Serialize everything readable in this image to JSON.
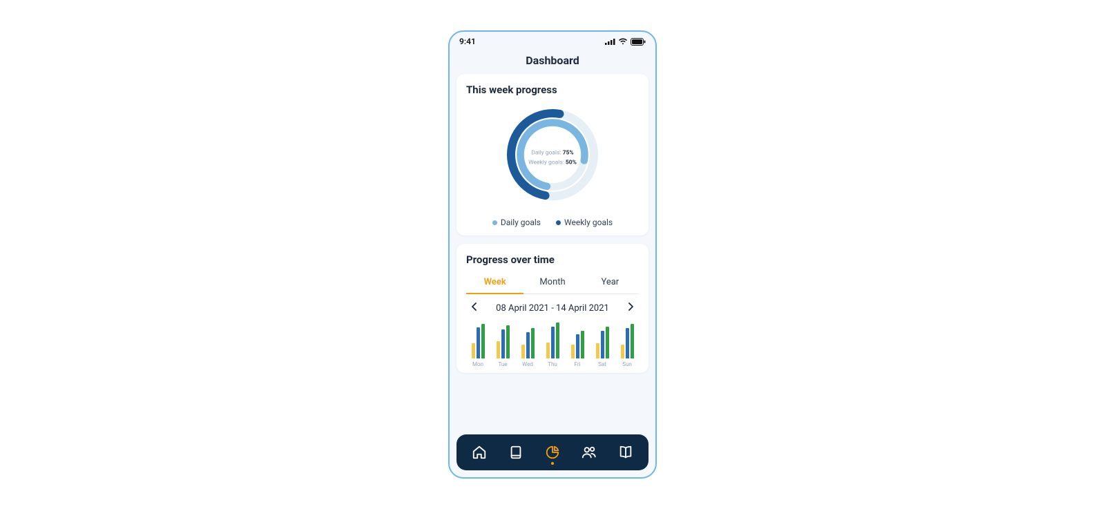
{
  "status": {
    "time": "9:41"
  },
  "page_title": "Dashboard",
  "week_card": {
    "title": "This week progress",
    "daily_label": "Daily goals:",
    "daily_value": "75%",
    "weekly_label": "Weekly goals:",
    "weekly_value": "50%",
    "legend_daily": "Daily goals",
    "legend_weekly": "Weekly goals",
    "colors": {
      "daily": "#7ab6e0",
      "weekly": "#1d5a9a",
      "track": "#e6eef6"
    }
  },
  "over_time": {
    "title": "Progress over time",
    "tabs": [
      "Week",
      "Month",
      "Year"
    ],
    "active_tab": 0,
    "range": "08 April 2021 - 14 April 2021"
  },
  "chart_data": {
    "type": "bar",
    "categories": [
      "Mon",
      "Tue",
      "Wed",
      "Thu",
      "Fri",
      "Sat",
      "Sun"
    ],
    "series": [
      {
        "name": "Yellow",
        "color": "#f2c94c",
        "values": [
          22,
          25,
          20,
          23,
          20,
          22,
          20
        ]
      },
      {
        "name": "Blue",
        "color": "#2a6db3",
        "values": [
          45,
          42,
          38,
          46,
          35,
          40,
          44
        ]
      },
      {
        "name": "Green",
        "color": "#2f9e44",
        "values": [
          50,
          48,
          44,
          52,
          40,
          46,
          50
        ]
      }
    ],
    "ylim": [
      0,
      56
    ],
    "xlabel": "",
    "ylabel": "",
    "title": ""
  },
  "nav": {
    "items": [
      "home",
      "book",
      "stats",
      "people",
      "library"
    ],
    "active": 2
  }
}
